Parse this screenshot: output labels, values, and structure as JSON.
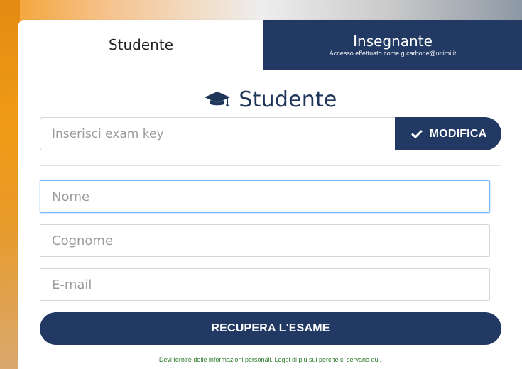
{
  "tabs": {
    "student": "Studente",
    "teacher": "Insegnante",
    "teacher_sub": "Accesso effettuato come g.carbone@unimi.it"
  },
  "form": {
    "title": "Studente",
    "exam_key": {
      "placeholder": "Inserisci exam key",
      "value": ""
    },
    "modify_button": "MODIFICA",
    "fields": {
      "name_placeholder": "Nome",
      "surname_placeholder": "Cognome",
      "email_placeholder": "E-mail"
    },
    "submit_label": "RECUPERA L'ESAME",
    "privacy_prefix": "Devi fornire delle informazioni personali. Leggi di più sul perché ci servano ",
    "privacy_link": "qui",
    "privacy_suffix": "."
  },
  "icons": {
    "heading_icon": "graduation-cap-icon",
    "modify_icon": "check-icon"
  },
  "colors": {
    "primary": "#223a63",
    "focus": "#79b6ff",
    "note_green": "#2a7a2a"
  }
}
